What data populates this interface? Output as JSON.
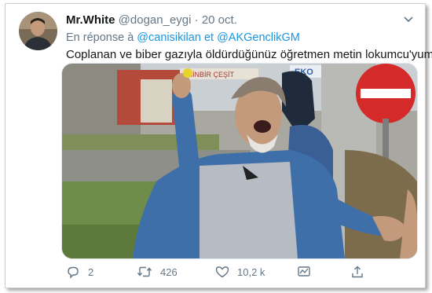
{
  "tweet": {
    "display_name": "Mr.White",
    "handle": "@dogan_eygi",
    "separator": "·",
    "date": "20 oct.",
    "reply_prefix": "En réponse à",
    "reply_to_1": "@canisikilan",
    "reply_joiner": "et",
    "reply_to_2": "@AKGenclikGM",
    "text": "Coplanan ve biber gazıyla öldürdüğünüz öğretmen metin lokumcu'yum...",
    "media_sign_texts": [
      "BİNBİR ÇEŞİT",
      "EKO"
    ]
  },
  "actions": {
    "replies": "2",
    "retweets": "426",
    "likes": "10,2 k"
  },
  "icons": [
    "chevron-down-icon",
    "reply-icon",
    "retweet-icon",
    "like-icon",
    "activity-icon",
    "share-icon"
  ],
  "colors": {
    "link": "#1b95e0",
    "muted": "#657786",
    "text": "#14171a",
    "no_entry_sign": "#d42a2a"
  }
}
